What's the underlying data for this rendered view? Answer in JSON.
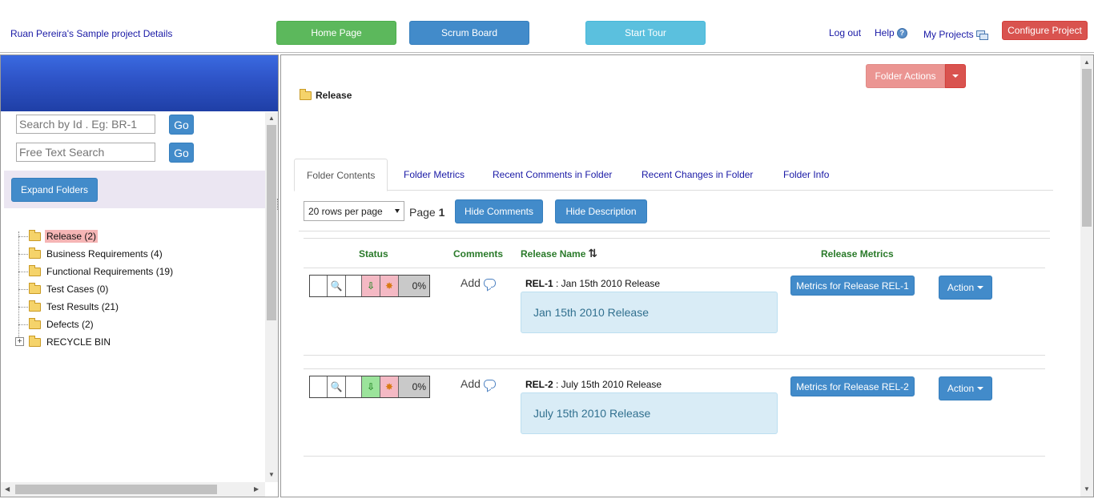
{
  "header": {
    "project_title": "Ruan Pereira's Sample project Details",
    "home_label": "Home Page",
    "scrum_label": "Scrum Board",
    "tour_label": "Start Tour",
    "logout_label": "Log out",
    "help_label": "Help",
    "my_projects_label": "My Projects",
    "configure_label": "Configure Project"
  },
  "sidebar": {
    "search_id_placeholder": "Search by Id . Eg: BR-1",
    "search_text_placeholder": "Free Text Search",
    "go_label": "Go",
    "expand_label": "Expand Folders",
    "tree": [
      {
        "label": "Release (2)",
        "selected": true
      },
      {
        "label": "Business Requirements (4)"
      },
      {
        "label": "Functional Requirements (19)"
      },
      {
        "label": "Test Cases (0)"
      },
      {
        "label": "Test Results (21)"
      },
      {
        "label": "Defects (2)"
      },
      {
        "label": "RECYCLE BIN"
      }
    ]
  },
  "main": {
    "folder_actions_label": "Folder Actions",
    "breadcrumb": "Release",
    "tabs": [
      {
        "label": "Folder Contents",
        "active": true
      },
      {
        "label": "Folder Metrics"
      },
      {
        "label": "Recent Comments in Folder"
      },
      {
        "label": "Recent Changes in Folder"
      },
      {
        "label": "Folder Info"
      }
    ],
    "rows_per_page": "20 rows per page",
    "page_prefix": "Page",
    "page_number": "1",
    "hide_comments_label": "Hide Comments",
    "hide_description_label": "Hide Description",
    "columns": {
      "status": "Status",
      "comments": "Comments",
      "name": "Release Name",
      "sort_glyph": "⇅",
      "metrics": "Release Metrics"
    },
    "rows": [
      {
        "id": "REL-1",
        "title": " : Jan 15th 2010 Release",
        "description": "Jan 15th 2010 Release",
        "progress": "0%",
        "add_label": "Add",
        "metrics_label": "Metrics for Release REL-1",
        "action_label": "Action",
        "status_green": false
      },
      {
        "id": "REL-2",
        "title": " : July 15th 2010 Release",
        "description": "July 15th 2010 Release",
        "progress": "0%",
        "add_label": "Add",
        "metrics_label": "Metrics for Release REL-2",
        "action_label": "Action",
        "status_green": true
      }
    ]
  },
  "colors": {
    "home": "#5cb85c",
    "scrum": "#428bca",
    "tour": "#5bc0de",
    "configure": "#d9534f",
    "folder_actions": "#eb9592",
    "selected_folder": "#f5b5b5",
    "status_green": "#9be39b",
    "status_pink": "#f4b9c4"
  },
  "icons": {
    "search_cell": "magnifier-icon",
    "down_cell": "down-arrow-icon",
    "burst_cell": "star-burst-icon"
  }
}
